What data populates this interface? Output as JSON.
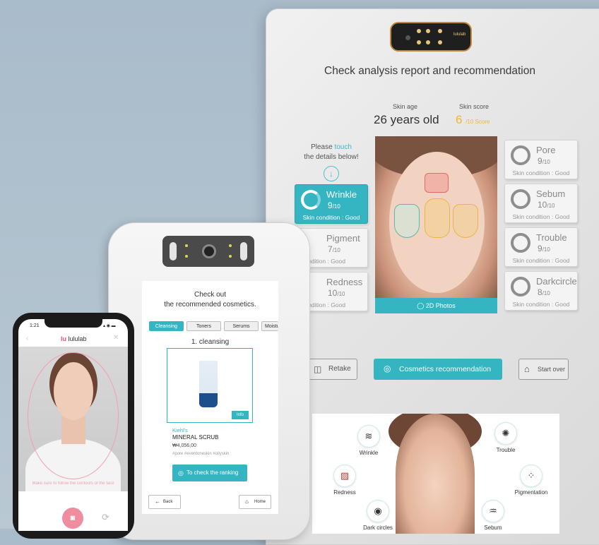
{
  "mirror": {
    "title": "Check analysis report and recommendation",
    "sensor_brand": "lululab",
    "skin_age": {
      "label": "Skin age",
      "value": "26 years old"
    },
    "skin_score": {
      "label": "Skin score",
      "value": "6",
      "unit": "/10 Score"
    },
    "touch_hint": {
      "pre": "Please ",
      "highlight": "touch",
      "post": "the details below!"
    },
    "left_cards": [
      {
        "name": "Wrinkle",
        "score": "9",
        "of": "/10",
        "condition": "Skin condition : Good",
        "active": true
      },
      {
        "name": "Pigment",
        "score": "7",
        "of": "/10",
        "condition": "n condition : Good",
        "active": false
      },
      {
        "name": "Redness",
        "score": "10",
        "of": "/10",
        "condition": "n condition : Good",
        "active": false
      }
    ],
    "right_cards": [
      {
        "name": "Pore",
        "score": "9",
        "of": "/10",
        "condition": "Skin condition : Good"
      },
      {
        "name": "Sebum",
        "score": "10",
        "of": "/10",
        "condition": "Skin condition : Good"
      },
      {
        "name": "Trouble",
        "score": "9",
        "of": "/10",
        "condition": "Skin condition : Good"
      },
      {
        "name": "Darkcircle",
        "score": "8",
        "of": "/10",
        "condition": "Skin condition : Good"
      }
    ],
    "photos_label": "2D Photos",
    "buttons": {
      "retake": "Retake",
      "cosmetics": "Cosmetics recommendation",
      "start_over": "Start over"
    },
    "colors": {
      "accent": "#35b5c2",
      "score": "#f0b43a"
    }
  },
  "infographic": {
    "features": [
      "Wrinkle",
      "Trouble",
      "Redness",
      "Pigmentation",
      "Dark circles",
      "Sebum"
    ]
  },
  "tablet": {
    "title_line1": "Check out",
    "title_line2": "the recommended cosmetics.",
    "tabs": [
      "Cleansing",
      "Toners",
      "Serums",
      "Moistu"
    ],
    "section": "1. cleansing",
    "info_label": "Info",
    "brand": "Kiehl's",
    "product": "MINERAL SCRUB",
    "price": "₩4,056,00",
    "tags": "#pore #eventoneskin #oilyskin",
    "rank_button": "To check the ranking",
    "back_button": "Back",
    "home_button": "Home"
  },
  "phone": {
    "time": "1:21",
    "status": "▴ ◉ ▬",
    "logo_mark": "lu",
    "logo": "lululab",
    "hint": "Make sure to follow the contours of the face"
  }
}
